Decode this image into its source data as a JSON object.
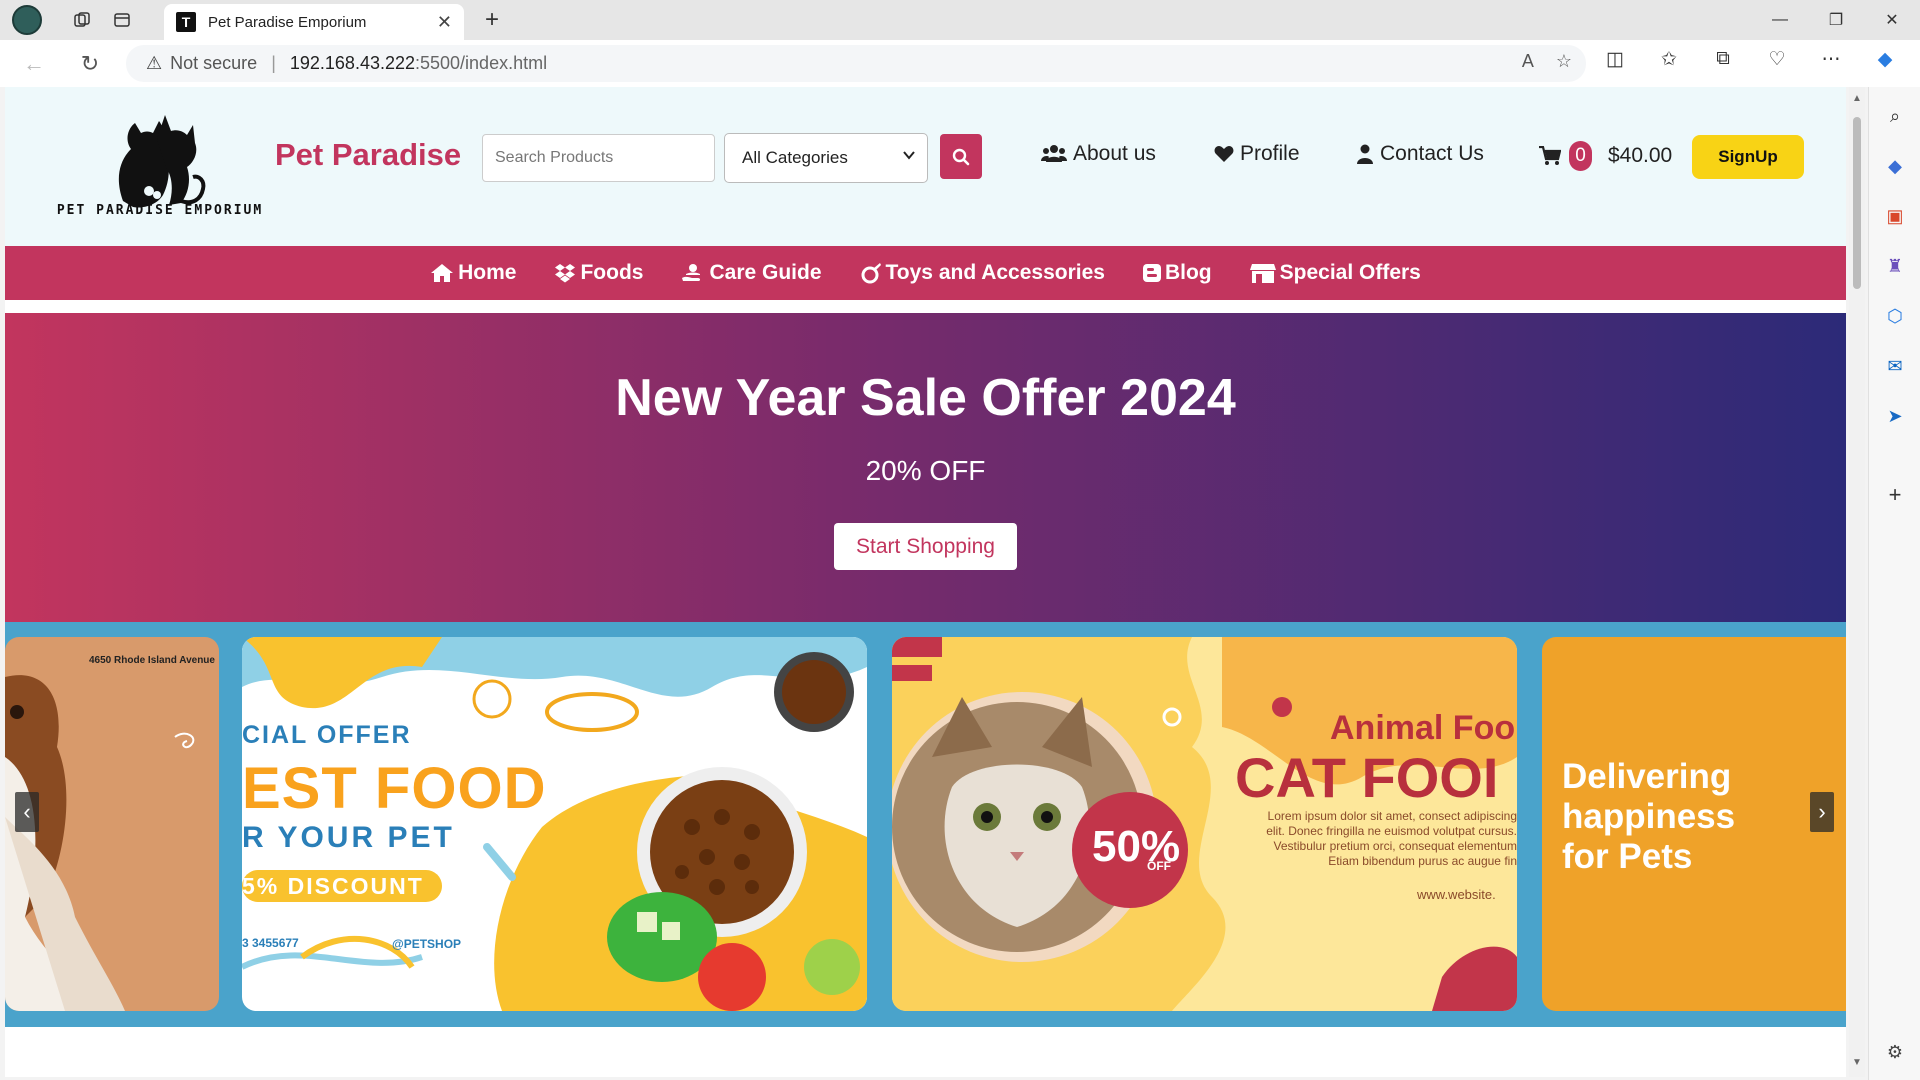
{
  "browser": {
    "tab_title": "Pet Paradise Emporium",
    "tab_favicon": "T",
    "security_label": "Not secure",
    "url_host": "192.168.43.222",
    "url_path": ":5500/index.html"
  },
  "header": {
    "brand": "Pet Paradise",
    "logo_text": "PET PARADISE EMPORIUM",
    "search_placeholder": "Search Products",
    "category_selected": "All Categories",
    "links": {
      "about": "About us",
      "profile": "Profile",
      "contact": "Contact Us"
    },
    "cart_count": "0",
    "cart_total": "$40.00",
    "signup": "SignUp"
  },
  "nav": {
    "home": "Home",
    "foods": "Foods",
    "care": "Care Guide",
    "toys": "Toys and Accessories",
    "blog": "Blog",
    "offers": "Special Offers"
  },
  "hero": {
    "title": "New Year Sale Offer 2024",
    "subtitle": "20% OFF",
    "button": "Start Shopping"
  },
  "carousel": {
    "slide1_address": "4650  Rhode Island Avenue",
    "slide2_line1": "CIAL OFFER",
    "slide2_line2": "EST FOOD",
    "slide2_line3": "R YOUR PET",
    "slide2_line4": "5% DISCOUNT",
    "slide2_phone": "3 3455677",
    "slide2_handle": "@PETSHOP",
    "slide3_line1": "Animal Foo",
    "slide3_line2": "CAT FOOI",
    "slide3_badge": "50%",
    "slide3_badge_sub": "OFF",
    "slide3_body": "Lorem ipsum dolor sit amet, consect adipiscing elit. Donec fringilla ne euismod volutpat cursus. Vestibulur pretium orci, consequat elementum Etiam bibendum purus ac augue fin",
    "slide3_site": "www.website.",
    "slide4_text": "Delivering happiness for Pets"
  },
  "colors": {
    "brand": "#c2355e",
    "signup": "#f8d315",
    "carousel_bg": "#4aa3cb"
  }
}
